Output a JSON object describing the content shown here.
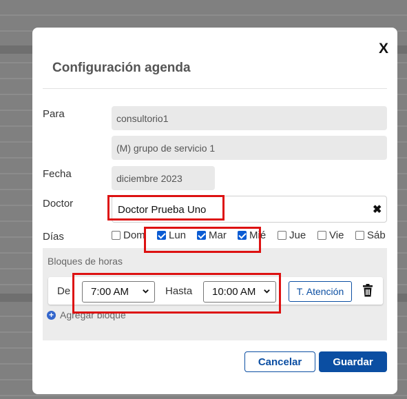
{
  "modal": {
    "title": "Configuración agenda",
    "close_label": "X",
    "para_label": "Para",
    "para_values": [
      "consultorio1",
      "(M) grupo de servicio 1"
    ],
    "fecha_label": "Fecha",
    "fecha_value": "diciembre 2023",
    "doctor_label": "Doctor",
    "doctor_value": "Doctor Prueba Uno",
    "clear_label": "✖",
    "dias_label": "Días",
    "days": [
      {
        "label": "Dom",
        "checked": false
      },
      {
        "label": "Lun",
        "checked": true
      },
      {
        "label": "Mar",
        "checked": true
      },
      {
        "label": "Mié",
        "checked": true
      },
      {
        "label": "Jue",
        "checked": false
      },
      {
        "label": "Vie",
        "checked": false
      },
      {
        "label": "Sáb",
        "checked": false
      }
    ],
    "blocks": {
      "title": "Bloques de horas",
      "de_label": "De",
      "de_value": "7:00 AM",
      "hasta_label": "Hasta",
      "hasta_value": "10:00 AM",
      "attention_button": "T. Atención",
      "add_block_label": "Agregar bloque"
    },
    "cancel_label": "Cancelar",
    "save_label": "Guardar"
  },
  "colors": {
    "accent": "#0b4ea2",
    "checkbox": "#0a5bd3",
    "highlight": "#dd1111"
  }
}
